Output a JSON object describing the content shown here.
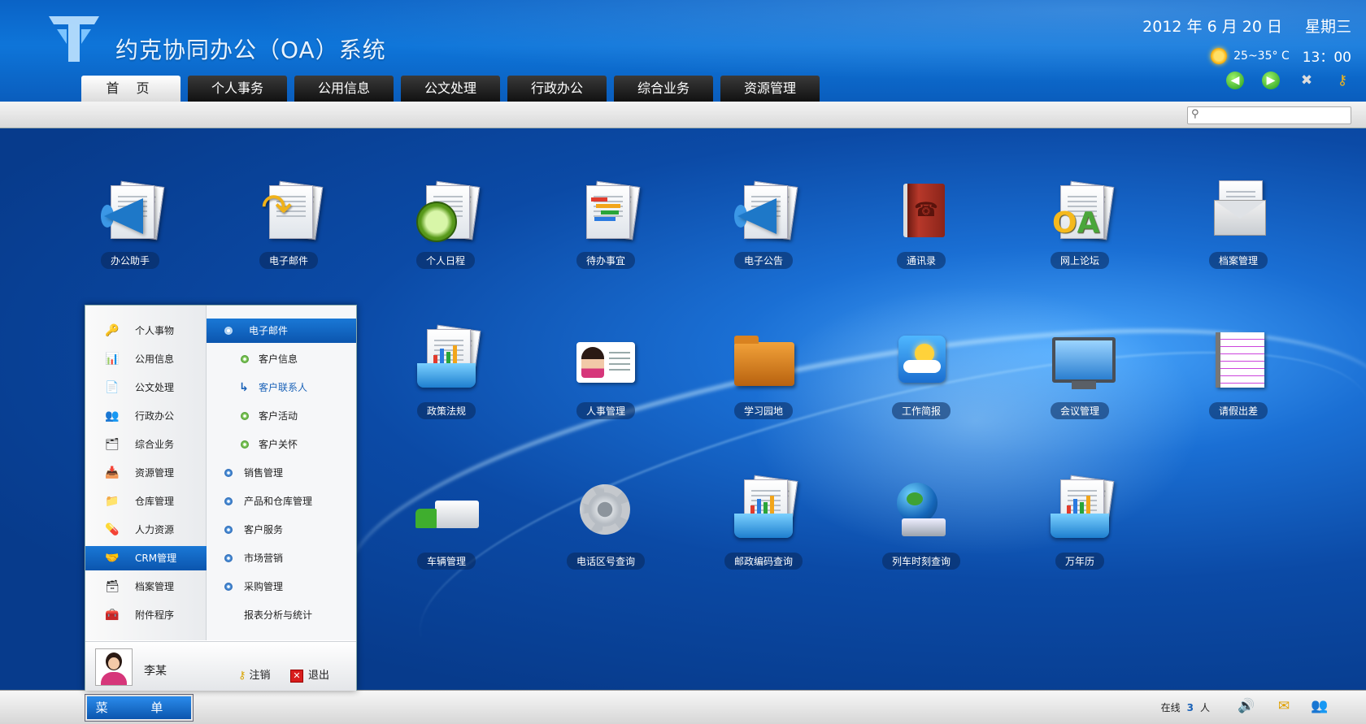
{
  "header": {
    "title": "约克协同办公（OA）系统",
    "date": "2012 年 6 月 20 日",
    "weekday": "星期三",
    "temperature": "25~35° C",
    "time": "13：00",
    "tools": [
      "back-arrow-icon",
      "forward-arrow-icon",
      "settings-tools-icon",
      "key-icon"
    ]
  },
  "nav": {
    "tabs": [
      "首 页",
      "个人事务",
      "公用信息",
      "公文处理",
      "行政办公",
      "综合业务",
      "资源管理"
    ],
    "active": 0
  },
  "search": {
    "placeholder": ""
  },
  "desktop": {
    "row1": [
      "办公助手",
      "电子邮件",
      "个人日程",
      "待办事宜",
      "电子公告",
      "通讯录",
      "网上论坛",
      "档案管理"
    ],
    "row2": [
      "政策法规",
      "人事管理",
      "学习园地",
      "工作简报",
      "会议管理",
      "请假出差"
    ],
    "row3": [
      "车辆管理",
      "电话区号查询",
      "邮政编码查询",
      "列车时刻查询",
      "万年历"
    ]
  },
  "start_menu": {
    "left_items": [
      "个人事物",
      "公用信息",
      "公文处理",
      "行政办公",
      "综合业务",
      "资源管理",
      "仓库管理",
      "人力资源",
      "CRM管理",
      "档案管理",
      "附件程序"
    ],
    "active_left": "CRM管理",
    "right_header": "电子邮件",
    "right_sub": [
      "客户信息",
      "客户联系人",
      "客户活动",
      "客户关怀"
    ],
    "right_items": [
      "销售管理",
      "产品和仓库管理",
      "客户服务",
      "市场营销",
      "采购管理",
      "报表分析与统计"
    ],
    "username": "李某",
    "logout": "注销",
    "exit": "退出"
  },
  "taskbar": {
    "start_label": "菜 单",
    "online_prefix": "在线",
    "online_count": "3",
    "online_suffix": "人",
    "icons": [
      "speaker-icon",
      "mail-icon",
      "users-icon"
    ]
  },
  "colors": {
    "accent": "#0b55ae",
    "header": "#0a63c6",
    "desktop": "#0b4aa6"
  }
}
